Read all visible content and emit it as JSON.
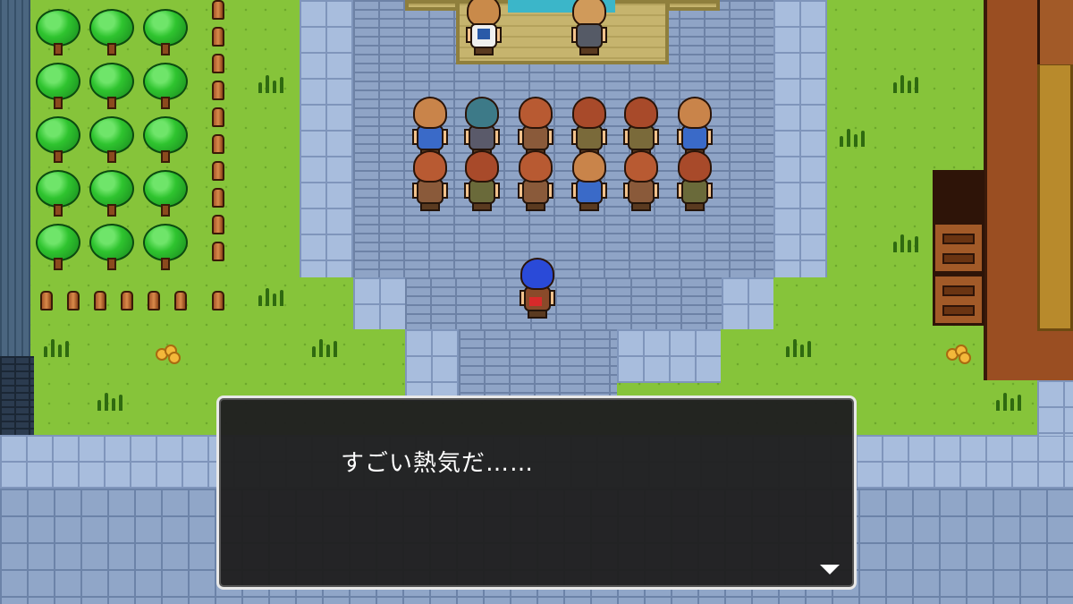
{
  "dialogue": {
    "text": "すごい熱気だ……",
    "advance_icon": "triangle-down-icon"
  },
  "colors": {
    "grass": "#86c43a",
    "road": "#8fa4c6",
    "window_bg": "#202020",
    "window_border": "#e8e8e8",
    "text": "#ffffff"
  }
}
